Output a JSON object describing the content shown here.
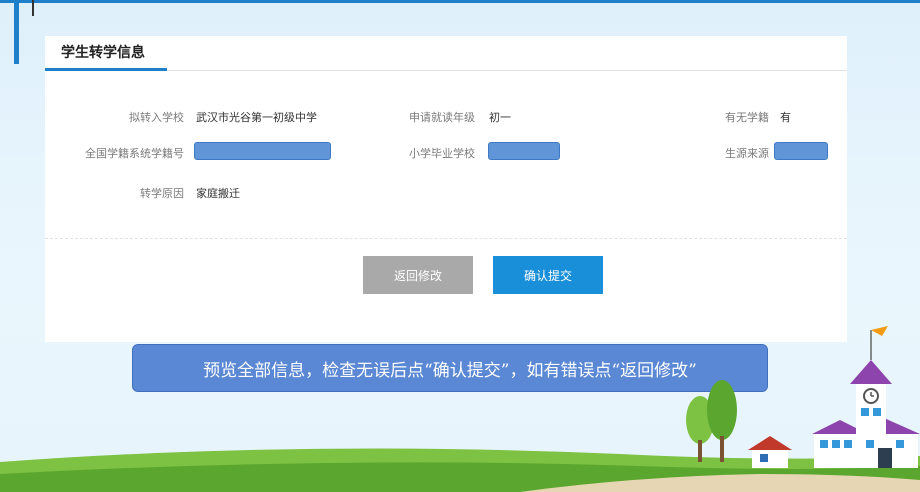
{
  "section_title": "学生转学信息",
  "fields": {
    "target_school_label": "拟转入学校",
    "target_school_value": "武汉市光谷第一初级中学",
    "grade_label": "申请就读年级",
    "grade_value": "初一",
    "has_registry_label": "有无学籍",
    "has_registry_value": "有",
    "national_id_label": "全国学籍系统学籍号",
    "primary_school_label": "小学毕业学校",
    "student_source_label": "生源来源",
    "reason_label": "转学原因",
    "reason_value": "家庭搬迁"
  },
  "buttons": {
    "back_label": "返回修改",
    "submit_label": "确认提交"
  },
  "tip_text": "预览全部信息，检查无误后点“确认提交”，如有错误点“返回修改”",
  "colors": {
    "accent": "#1f7fc8",
    "submit_button": "#1a8fd9",
    "back_button": "#a9a9a9",
    "redaction_mask": "#6096d8",
    "tip_banner": "#5a88d4"
  }
}
